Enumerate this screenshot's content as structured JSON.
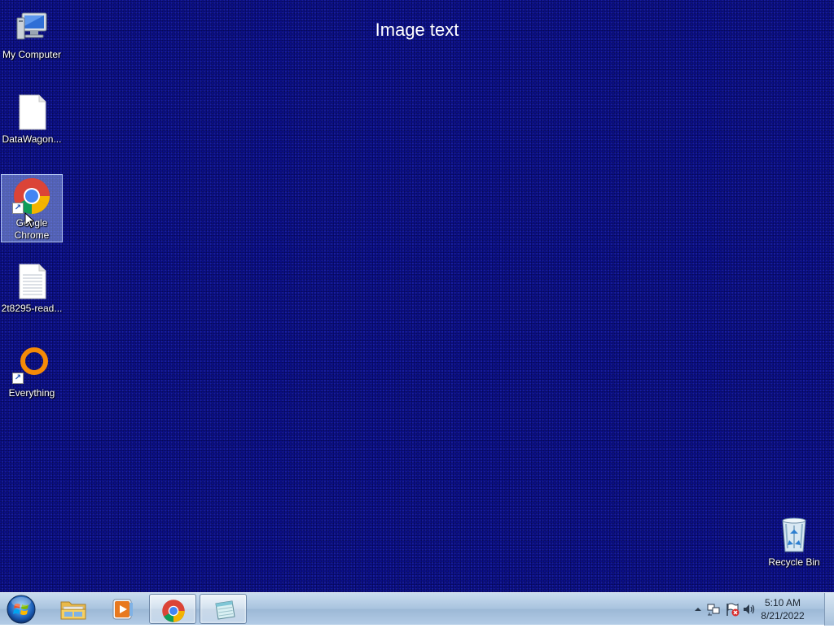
{
  "banner": {
    "text": "Image text"
  },
  "desktop_icons": [
    {
      "label": "My Computer",
      "icon": "computer-icon",
      "selected": false
    },
    {
      "label": "DataWagon...",
      "icon": "blank-file-icon",
      "selected": false
    },
    {
      "label_line1": "Google",
      "label_line2": "Chrome",
      "icon": "chrome-icon",
      "selected": true,
      "shortcut": true
    },
    {
      "label": "2t8295-read...",
      "icon": "text-file-icon",
      "selected": false
    },
    {
      "label": "Everything",
      "icon": "everything-icon",
      "selected": false,
      "shortcut": true
    },
    {
      "label": "Recycle Bin",
      "icon": "recycle-bin-icon",
      "selected": false
    }
  ],
  "taskbar": {
    "start_icon": "windows-start-icon",
    "pinned": [
      {
        "name": "file-explorer",
        "icon": "folder-icon",
        "active": false
      },
      {
        "name": "media-player",
        "icon": "media-player-icon",
        "active": false
      },
      {
        "name": "google-chrome",
        "icon": "chrome-icon",
        "active": true
      },
      {
        "name": "notepad",
        "icon": "notepad-icon",
        "active": true
      }
    ],
    "tray": {
      "icons": [
        "show-hidden-icons-arrow",
        "network-icon",
        "action-center-flag-icon",
        "volume-icon"
      ],
      "time": "5:10 AM",
      "date": "8/21/2022"
    }
  },
  "colors": {
    "desktop_background": "#0b0f86",
    "taskbar": "#b3cce6",
    "selection": "#aac8ff"
  }
}
